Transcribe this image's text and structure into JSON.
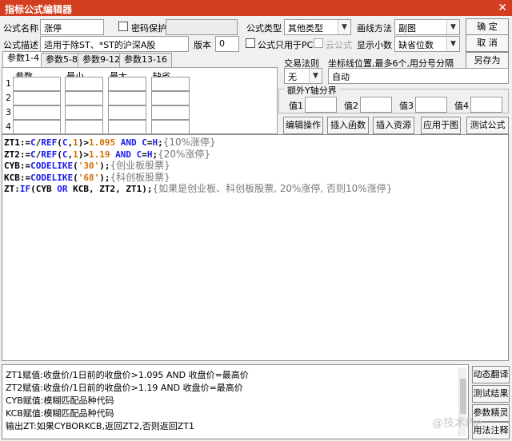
{
  "window": {
    "title": "指标公式编辑器",
    "close_glyph": "✕"
  },
  "form": {
    "name_label": "公式名称",
    "name_value": "涨停",
    "password_label": "密码保护",
    "password_value": "",
    "desc_label": "公式描述",
    "desc_value": "适用于除ST、*ST的沪深A股",
    "version_label": "版本",
    "version_value": "0",
    "type_label": "公式类型",
    "type_value": "其他类型",
    "draw_label": "画线方法",
    "draw_value": "副图",
    "pc_only_label": "公式只用于PC",
    "cloud_label": "云公式",
    "decimals_label": "显示小数",
    "decimals_value": "缺省位数",
    "trade_rule_label": "交易法则",
    "trade_rule_value": "无",
    "axis_label": "坐标线位置,最多6个,用分号分隔",
    "axis_value": "自动",
    "extra_y_label": "额外Y轴分界",
    "y_values": [
      {
        "label": "值1",
        "value": ""
      },
      {
        "label": "值2",
        "value": ""
      },
      {
        "label": "值3",
        "value": ""
      },
      {
        "label": "值4",
        "value": ""
      }
    ]
  },
  "buttons": {
    "ok": "确 定",
    "cancel": "取 消",
    "save_as": "另存为",
    "edit_ops": "编辑操作",
    "insert_func": "插入函数",
    "insert_resource": "插入资源",
    "apply_chart": "应用于图",
    "test_formula": "测试公式"
  },
  "tabs": [
    "参数1-4",
    "参数5-8",
    "参数9-12",
    "参数13-16"
  ],
  "param_table": {
    "headers": [
      "参数",
      "最小",
      "最大",
      "缺省"
    ],
    "rows": [
      "1",
      "2",
      "3",
      "4"
    ]
  },
  "code": {
    "l1": {
      "a": "ZT1:=",
      "b": "C",
      "c": "/",
      "d": "REF",
      "e": "(",
      "f": "C",
      "g": ",",
      "h": "1",
      "i": ")>",
      "j": "1.095",
      "k": " AND ",
      "l": "C",
      "m": "=",
      "n": "H",
      "o": ";",
      "p": "{10%涨停}"
    },
    "l2": {
      "a": "ZT2:=",
      "b": "C",
      "c": "/",
      "d": "REF",
      "e": "(",
      "f": "C",
      "g": ",",
      "h": "1",
      "i": ")>",
      "j": "1.19",
      "k": " AND ",
      "l": "C",
      "m": "=",
      "n": "H",
      "o": ";",
      "p": "{20%涨停}"
    },
    "l3": {
      "a": "CYB:=",
      "b": "CODELIKE",
      "c": "(",
      "d": "'30'",
      "e": ");",
      "p": "{创业板股票}"
    },
    "l4": {
      "a": "KCB:=",
      "b": "CODELIKE",
      "c": "(",
      "d": "'68'",
      "e": ");",
      "p": "{科创板股票}"
    },
    "l5": {
      "a": "ZT:",
      "b": "IF",
      "c": "(CYB ",
      "d": "OR",
      "e": " KCB, ZT2, ZT1);",
      "p": "{如果是创业板、科创板股票, 20%涨停, 否则10%涨停}"
    }
  },
  "output_lines": [
    "ZT1赋值:收盘价/1日前的收盘价>1.095 AND 收盘价=最高价",
    "ZT2赋值:收盘价/1日前的收盘价>1.19 AND 收盘价=最高价",
    "CYB赋值:模糊匹配品种代码",
    "KCB赋值:模糊匹配品种代码",
    "输出ZT:如果CYBORKCB,返回ZT2,否则返回ZT1"
  ],
  "side_buttons": [
    "动态翻译",
    "测试结果",
    "参数精灵",
    "用法注释"
  ],
  "watermark": "@技术Pie"
}
